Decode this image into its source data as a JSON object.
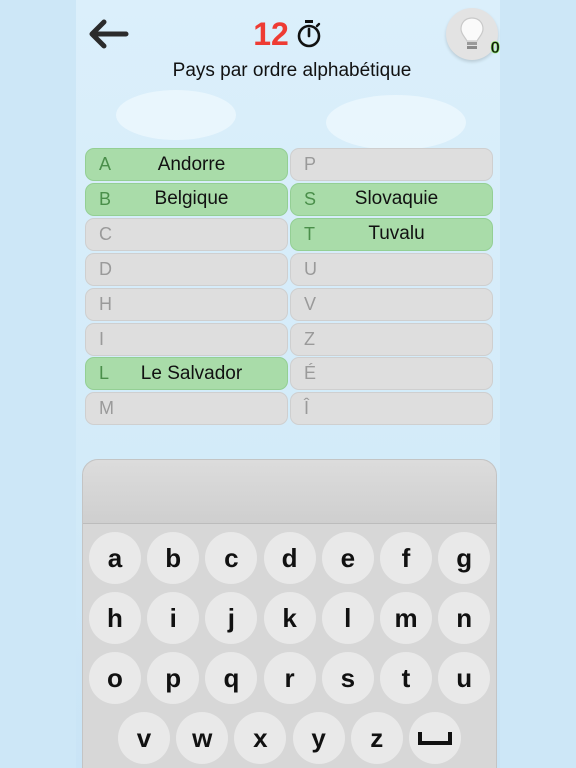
{
  "header": {
    "back_icon": "arrow-left-icon",
    "timer_value": "12",
    "timer_icon": "stopwatch-icon",
    "subtitle": "Pays par ordre alphabétique",
    "hint_icon": "lightbulb-icon",
    "hint_count": "0"
  },
  "colors": {
    "timer": "#ee3b33",
    "found_slot": "#a9dca9",
    "empty_slot": "#dedede",
    "background": "#cde7f7"
  },
  "slots": [
    {
      "letter": "A",
      "word": "Andorre",
      "found": true
    },
    {
      "letter": "P",
      "word": "",
      "found": false
    },
    {
      "letter": "B",
      "word": "Belgique",
      "found": true
    },
    {
      "letter": "S",
      "word": "Slovaquie",
      "found": true
    },
    {
      "letter": "C",
      "word": "",
      "found": false
    },
    {
      "letter": "T",
      "word": "Tuvalu",
      "found": true
    },
    {
      "letter": "D",
      "word": "",
      "found": false
    },
    {
      "letter": "U",
      "word": "",
      "found": false
    },
    {
      "letter": "H",
      "word": "",
      "found": false
    },
    {
      "letter": "V",
      "word": "",
      "found": false
    },
    {
      "letter": "I",
      "word": "",
      "found": false
    },
    {
      "letter": "Z",
      "word": "",
      "found": false
    },
    {
      "letter": "L",
      "word": "Le Salvador",
      "found": true
    },
    {
      "letter": "É",
      "word": "",
      "found": false
    },
    {
      "letter": "M",
      "word": "",
      "found": false
    },
    {
      "letter": "Î",
      "word": "",
      "found": false
    }
  ],
  "keyboard": {
    "input_value": "",
    "rows": [
      [
        "a",
        "b",
        "c",
        "d",
        "e",
        "f",
        "g"
      ],
      [
        "h",
        "i",
        "j",
        "k",
        "l",
        "m",
        "n"
      ],
      [
        "o",
        "p",
        "q",
        "r",
        "s",
        "t",
        "u"
      ],
      [
        "v",
        "w",
        "x",
        "y",
        "z"
      ]
    ],
    "space_icon": "space-bar-icon"
  }
}
